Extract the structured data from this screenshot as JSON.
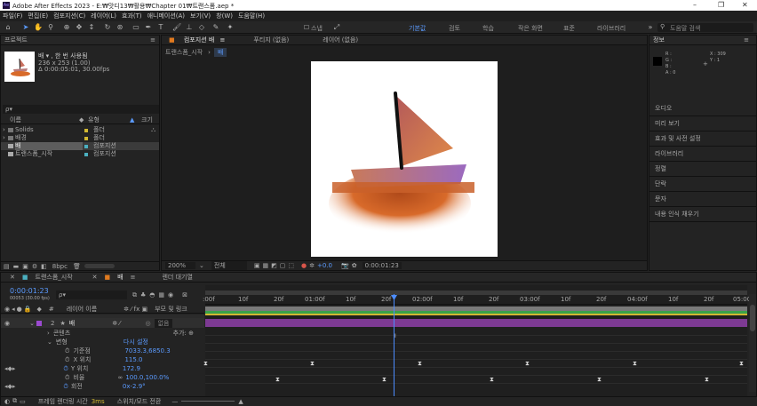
{
  "window": {
    "title": "Adobe After Effects 2023 - E:₩맛디13₩활용₩Chapter 01₩트랜스폼.aep *",
    "app_icon": "Ae",
    "controls": [
      "–",
      "❐",
      "✕"
    ]
  },
  "menu": [
    "파일(F)",
    "편집(E)",
    "컴포지션(C)",
    "레이어(L)",
    "효과(T)",
    "애니메이션(A)",
    "보기(V)",
    "창(W)",
    "도움말(H)"
  ],
  "toolbar": {
    "snap_label": "스냅",
    "workspaces": [
      "기본값",
      "검토",
      "학습",
      "작은 화면",
      "표준",
      "라이브러리"
    ],
    "search_placeholder": "도움말 검색"
  },
  "project": {
    "tab": "프로젝트",
    "comp_name": "배 ▾ , 한 번 사용됨",
    "comp_size": "236 x 253 (1.00)",
    "comp_duration": "Δ 0:00:05:01, 30.00fps",
    "search_placeholder": "ρ▾",
    "col_name": "이름",
    "col_type": "유형",
    "col_size": "크기",
    "items": [
      {
        "name": "Solids",
        "type": "폴더",
        "color": "#d1b832"
      },
      {
        "name": "배경",
        "type": "폴더",
        "color": "#d1b832"
      },
      {
        "name": "배",
        "type": "컴포지션",
        "color": "#4bb0c0"
      },
      {
        "name": "트랜스폼_시작",
        "type": "컴포지션",
        "color": "#4bb0c0"
      }
    ],
    "bpc": "8bpc"
  },
  "comp": {
    "tabs": [
      "컴포지션 배",
      "푸티지 (없음)",
      "레이어 (없음)"
    ],
    "breadcrumbs": [
      "트랜스폼_시작",
      "배"
    ],
    "zoom": "200%",
    "quality": "전체",
    "exposure": "+0.0",
    "timecode": "0:00:01:23"
  },
  "info": {
    "tab": "정보",
    "r": "R :",
    "g": "G :",
    "b": "B :",
    "a": "A : 0",
    "x": "X : 309",
    "y": "Y : 1"
  },
  "side_panels": [
    "오디오",
    "미리 보기",
    "효과 및 사전 설정",
    "라이브러리",
    "정렬",
    "단락",
    "문자",
    "내용 인식 채우기"
  ],
  "timeline": {
    "tabs": [
      "트랜스폼_시작",
      "배",
      "렌더 대기열"
    ],
    "timecode": "0:00:01:23",
    "timecode_sub": "00053 (30.00 fps)",
    "search_placeholder": "ρ▾",
    "col_num": "#",
    "col_name": "레이어 이름",
    "col_parent": "부모 및 링크",
    "ruler": [
      ":00f",
      "10f",
      "20f",
      "01:00f",
      "10f",
      "20f",
      "02:00f",
      "10f",
      "20f",
      "03:00f",
      "10f",
      "20f",
      "04:00f",
      "10f",
      "20f",
      "05:00"
    ],
    "layers": [
      {
        "num": "2",
        "name": "배",
        "parent": "없음"
      }
    ],
    "properties": [
      {
        "name": "콘텐츠",
        "value": "",
        "extra": "추가: ⊕"
      },
      {
        "name": "변형",
        "value": "다시 설정"
      },
      {
        "name": "기준점",
        "value": "7033.3,6850.3"
      },
      {
        "name": "X 위치",
        "value": "115.0"
      },
      {
        "name": "Y 위치",
        "value": "172.9"
      },
      {
        "name": "비율",
        "value": "100.0,100.0%"
      },
      {
        "name": "회전",
        "value": "0x-2.9°"
      }
    ],
    "footer": "프레임 렌더링 시간",
    "footer_ms": "3ms",
    "footer_toggle": "스위치/모드 전환"
  }
}
